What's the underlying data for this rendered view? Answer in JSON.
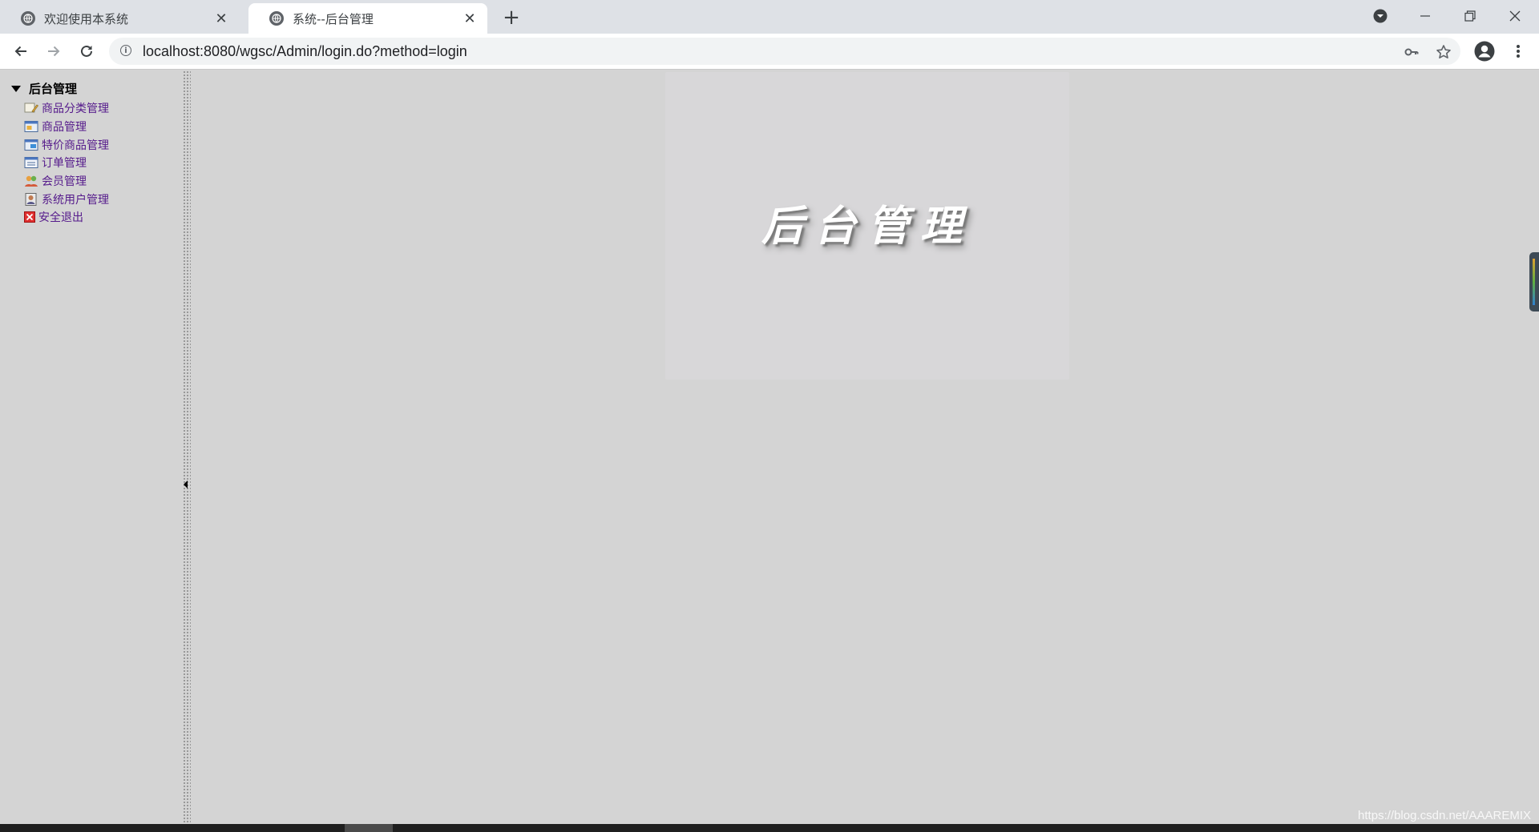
{
  "browser": {
    "tabs": [
      {
        "title": "欢迎使用本系统",
        "active": false
      },
      {
        "title": "系统--后台管理",
        "active": true
      }
    ],
    "new_tab_label": "+",
    "url": "localhost:8080/wgsc/Admin/login.do?method=login"
  },
  "sidebar": {
    "root_label": "后台管理",
    "items": [
      {
        "label": "商品分类管理",
        "icon": "category-edit-icon"
      },
      {
        "label": "商品管理",
        "icon": "product-window-icon"
      },
      {
        "label": "特价商品管理",
        "icon": "special-product-icon"
      },
      {
        "label": "订单管理",
        "icon": "order-list-icon"
      },
      {
        "label": "会员管理",
        "icon": "members-icon"
      },
      {
        "label": "系统用户管理",
        "icon": "system-user-icon"
      },
      {
        "label": "安全退出",
        "icon": "exit-icon"
      }
    ]
  },
  "main": {
    "banner_title": "后台管理"
  },
  "watermark": "https://blog.csdn.net/AAAREMIX",
  "colors": {
    "page_background": "#d4d4d4",
    "visited_link": "#551a8b"
  }
}
